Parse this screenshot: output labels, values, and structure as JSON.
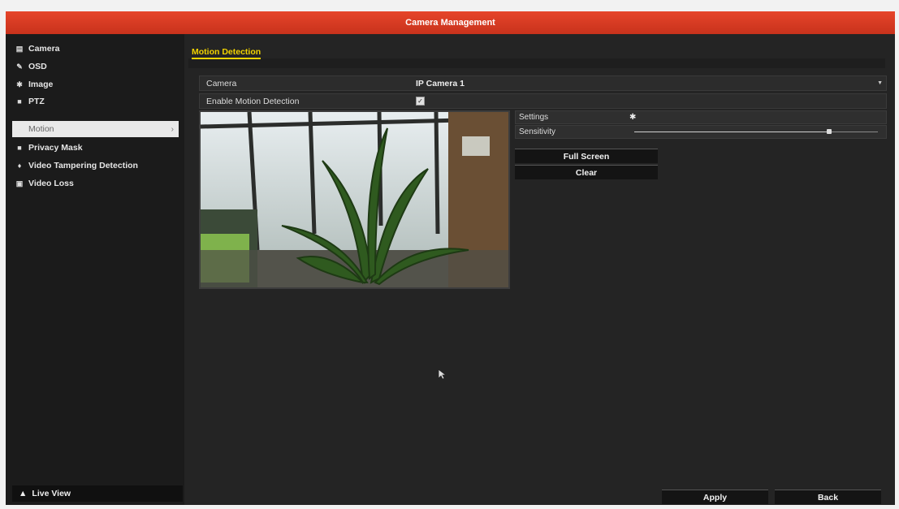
{
  "window": {
    "title": "Camera Management"
  },
  "sidebar": {
    "items": [
      {
        "label": "Camera",
        "icon": "camera-icon"
      },
      {
        "label": "OSD",
        "icon": "osd-icon"
      },
      {
        "label": "Image",
        "icon": "image-icon"
      },
      {
        "label": "PTZ",
        "icon": "ptz-icon"
      },
      {
        "label": "Motion",
        "icon": "motion-icon",
        "active": true
      },
      {
        "label": "Privacy Mask",
        "icon": "privacy-mask-icon"
      },
      {
        "label": "Video Tampering Detection",
        "icon": "tampering-icon"
      },
      {
        "label": "Video Loss",
        "icon": "video-loss-icon"
      }
    ],
    "live_view": "Live View"
  },
  "main": {
    "tab": "Motion Detection",
    "camera_label": "Camera",
    "camera_value": "IP Camera 1",
    "enable_label": "Enable Motion Detection",
    "enable_checked": true,
    "settings_label": "Settings",
    "sensitivity_label": "Sensitivity",
    "sensitivity_level": 0.8,
    "full_screen_label": "Full Screen",
    "clear_label": "Clear"
  },
  "footer": {
    "apply_label": "Apply",
    "back_label": "Back"
  },
  "colors": {
    "title_bar": "#d43a22",
    "tab_accent": "#f2d300",
    "background": "#242424"
  }
}
